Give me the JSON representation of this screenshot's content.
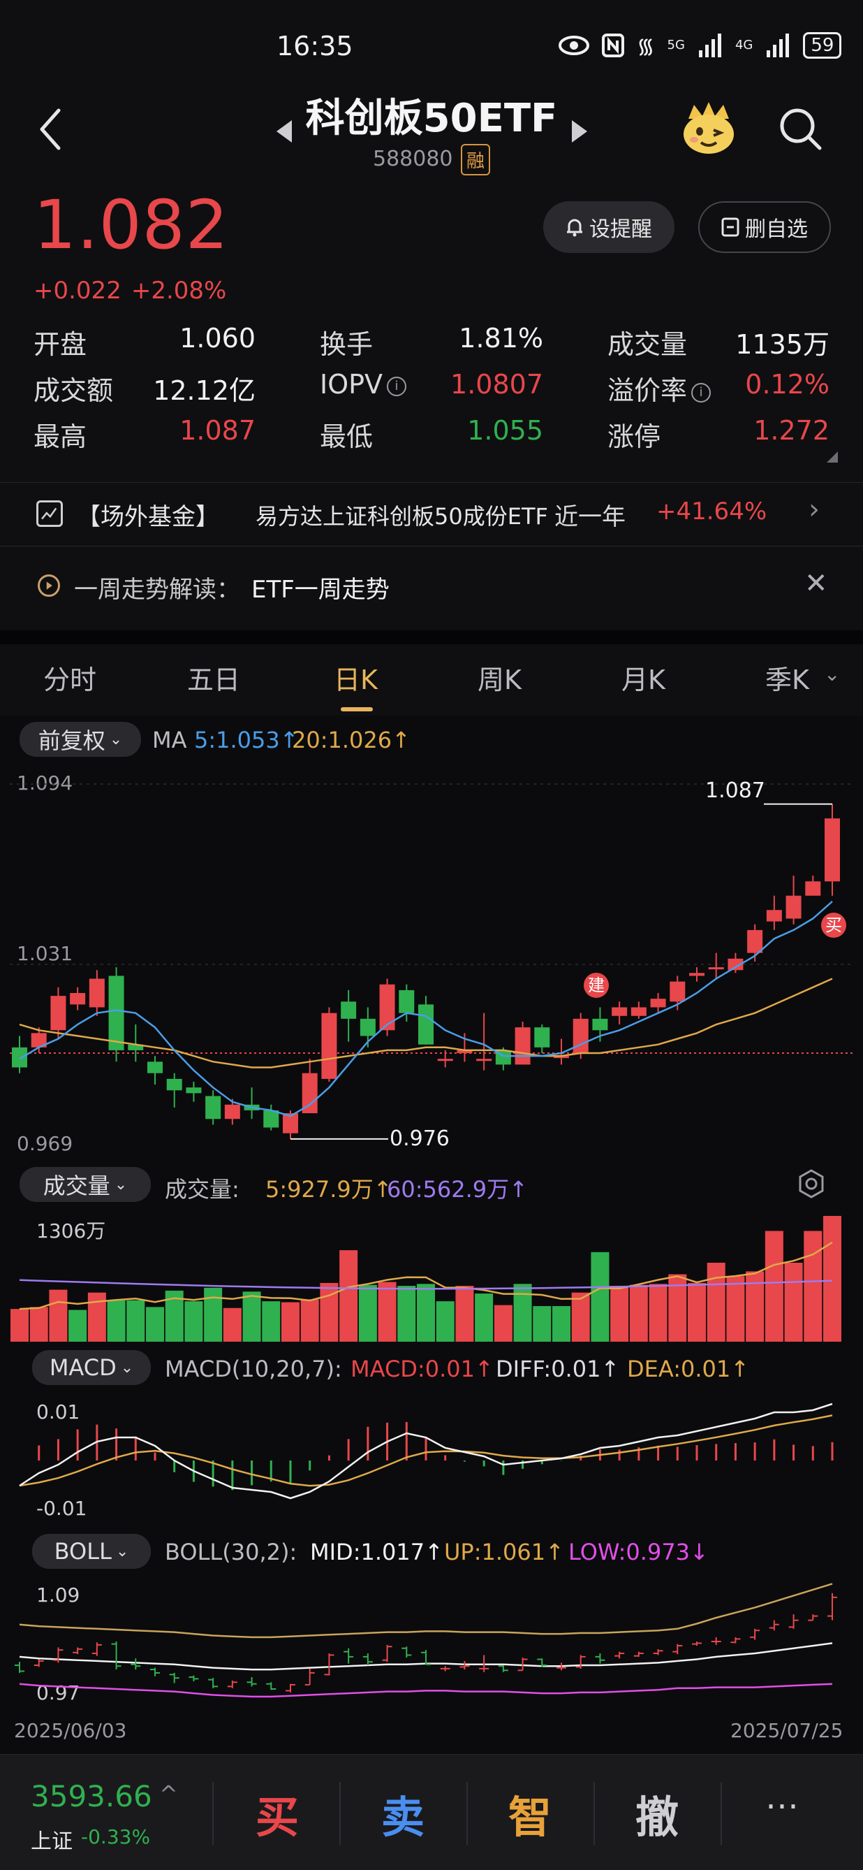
{
  "status": {
    "time": "16:35",
    "battery": "59",
    "signal1": "5G",
    "signal2": "4G"
  },
  "header": {
    "title": "科创板50ETF",
    "code": "588080",
    "badge": "融"
  },
  "price": {
    "last": "1.082",
    "change": "+0.022",
    "change_pct": "+2.08%"
  },
  "actions": {
    "alert": "设提醒",
    "fav": "删自选"
  },
  "stats": [
    {
      "label": "开盘",
      "value": "1.060",
      "tone": "white"
    },
    {
      "label": "换手",
      "value": "1.81%",
      "tone": "white"
    },
    {
      "label": "成交量",
      "value": "1135万",
      "tone": "white"
    },
    {
      "label": "成交额",
      "value": "12.12亿",
      "tone": "white"
    },
    {
      "label": "IOPV",
      "value": "1.0807",
      "tone": "red",
      "info": true
    },
    {
      "label": "溢价率",
      "value": "0.12%",
      "tone": "red",
      "info": true
    },
    {
      "label": "最高",
      "value": "1.087",
      "tone": "red"
    },
    {
      "label": "最低",
      "value": "1.055",
      "tone": "green"
    },
    {
      "label": "涨停",
      "value": "1.272",
      "tone": "red"
    }
  ],
  "fund": {
    "tag": "【场外基金】",
    "name": "易方达上证科创板50成份ETF",
    "period": "近一年",
    "return": "+41.64%"
  },
  "weekly": {
    "label": "一周走势解读：",
    "value": "ETF一周走势"
  },
  "tabs": [
    "分时",
    "五日",
    "日K",
    "周K",
    "月K",
    "季K"
  ],
  "active_tab": "日K",
  "kline": {
    "adjust": "前复权",
    "ma_label": "MA",
    "ma5": "5:1.053",
    "ma20": "20:1.026",
    "y_top": "1.094",
    "y_mid": "1.031",
    "y_bot": "0.969",
    "high_mark": "1.087",
    "low_mark": "0.976",
    "build_tag": "建",
    "buy_tag": "买",
    "colors": {
      "up": "#e8474b",
      "down": "#2fb14f",
      "ma5": "#4a9ee8",
      "ma20": "#e0a94a"
    }
  },
  "volume": {
    "selector": "成交量",
    "label": "成交量:",
    "ma5": "5:927.9万",
    "ma60": "60:562.9万",
    "y_top": "1306万",
    "y_bot": "0"
  },
  "macd": {
    "selector": "MACD",
    "params": "MACD(10,20,7):",
    "macd": "MACD:0.01",
    "diff": "DIFF:0.01",
    "dea": "DEA:0.01",
    "y_top": "0.01",
    "y_bot": "-0.01"
  },
  "boll": {
    "selector": "BOLL",
    "params": "BOLL(30,2):",
    "mid": "MID:1.017",
    "up": "UP:1.061",
    "low": "LOW:0.973",
    "y_top": "1.09",
    "y_bot": "0.97"
  },
  "dates": {
    "start": "2025/06/03",
    "end": "2025/07/25"
  },
  "chart_data": {
    "type": "candlestick",
    "x_range": [
      "2025/06/03",
      "2025/07/25"
    ],
    "ylim": [
      0.969,
      1.094
    ],
    "candles": [
      {
        "o": 1.002,
        "c": 0.995,
        "h": 1.006,
        "l": 0.993
      },
      {
        "o": 1.002,
        "c": 1.007,
        "h": 1.009,
        "l": 1.0
      },
      {
        "o": 1.008,
        "c": 1.02,
        "h": 1.023,
        "l": 1.005
      },
      {
        "o": 1.017,
        "c": 1.021,
        "h": 1.023,
        "l": 1.015
      },
      {
        "o": 1.016,
        "c": 1.026,
        "h": 1.029,
        "l": 1.013
      },
      {
        "o": 1.027,
        "c": 1.001,
        "h": 1.03,
        "l": 0.997
      },
      {
        "o": 1.003,
        "c": 1.001,
        "h": 1.01,
        "l": 0.997
      },
      {
        "o": 0.997,
        "c": 0.993,
        "h": 0.999,
        "l": 0.989
      },
      {
        "o": 0.991,
        "c": 0.987,
        "h": 0.993,
        "l": 0.981
      },
      {
        "o": 0.988,
        "c": 0.986,
        "h": 0.99,
        "l": 0.983
      },
      {
        "o": 0.985,
        "c": 0.977,
        "h": 0.987,
        "l": 0.975
      },
      {
        "o": 0.977,
        "c": 0.982,
        "h": 0.984,
        "l": 0.975
      },
      {
        "o": 0.982,
        "c": 0.98,
        "h": 0.988,
        "l": 0.977
      },
      {
        "o": 0.98,
        "c": 0.974,
        "h": 0.982,
        "l": 0.973
      },
      {
        "o": 0.972,
        "c": 0.979,
        "h": 0.98,
        "l": 0.97
      },
      {
        "o": 0.979,
        "c": 0.993,
        "h": 0.998,
        "l": 0.979
      },
      {
        "o": 0.991,
        "c": 1.014,
        "h": 1.016,
        "l": 0.99
      },
      {
        "o": 1.018,
        "c": 1.012,
        "h": 1.022,
        "l": 1.004
      },
      {
        "o": 1.012,
        "c": 1.006,
        "h": 1.016,
        "l": 1.002
      },
      {
        "o": 1.008,
        "c": 1.024,
        "h": 1.026,
        "l": 1.006
      },
      {
        "o": 1.022,
        "c": 1.014,
        "h": 1.024,
        "l": 1.011
      },
      {
        "o": 1.017,
        "c": 1.003,
        "h": 1.02,
        "l": 1.003
      },
      {
        "o": 0.998,
        "c": 0.998,
        "h": 1.001,
        "l": 0.995
      },
      {
        "o": 1.0,
        "c": 1.001,
        "h": 1.007,
        "l": 0.997
      },
      {
        "o": 0.998,
        "c": 0.998,
        "h": 1.014,
        "l": 0.994
      },
      {
        "o": 1.001,
        "c": 0.996,
        "h": 1.002,
        "l": 0.994
      },
      {
        "o": 0.996,
        "c": 1.009,
        "h": 1.011,
        "l": 0.996
      },
      {
        "o": 1.009,
        "c": 1.002,
        "h": 1.01,
        "l": 1.0
      },
      {
        "o": 0.999,
        "c": 0.999,
        "h": 1.005,
        "l": 0.996
      },
      {
        "o": 1.0,
        "c": 1.012,
        "h": 1.014,
        "l": 0.998
      },
      {
        "o": 1.012,
        "c": 1.008,
        "h": 1.016,
        "l": 1.004
      },
      {
        "o": 1.013,
        "c": 1.016,
        "h": 1.018,
        "l": 1.01
      },
      {
        "o": 1.013,
        "c": 1.016,
        "h": 1.018,
        "l": 1.012
      },
      {
        "o": 1.016,
        "c": 1.019,
        "h": 1.021,
        "l": 1.014
      },
      {
        "o": 1.018,
        "c": 1.025,
        "h": 1.027,
        "l": 1.015
      },
      {
        "o": 1.027,
        "c": 1.028,
        "h": 1.03,
        "l": 1.025
      },
      {
        "o": 1.03,
        "c": 1.03,
        "h": 1.035,
        "l": 1.026
      },
      {
        "o": 1.029,
        "c": 1.033,
        "h": 1.035,
        "l": 1.028
      },
      {
        "o": 1.035,
        "c": 1.043,
        "h": 1.045,
        "l": 1.032
      },
      {
        "o": 1.046,
        "c": 1.05,
        "h": 1.055,
        "l": 1.043
      },
      {
        "o": 1.047,
        "c": 1.055,
        "h": 1.062,
        "l": 1.045
      },
      {
        "o": 1.055,
        "c": 1.06,
        "h": 1.062,
        "l": 1.055
      },
      {
        "o": 1.06,
        "c": 1.082,
        "h": 1.087,
        "l": 1.055
      }
    ],
    "ma5": [
      0.998,
      1.002,
      1.005,
      1.01,
      1.014,
      1.015,
      1.014,
      1.009,
      1.001,
      0.994,
      0.988,
      0.983,
      0.981,
      0.98,
      0.978,
      0.982,
      0.988,
      0.996,
      1.004,
      1.01,
      1.014,
      1.013,
      1.008,
      1.005,
      1.003,
      0.999,
      0.999,
      0.999,
      1.0,
      1.003,
      1.006,
      1.008,
      1.011,
      1.014,
      1.017,
      1.021,
      1.026,
      1.03,
      1.034,
      1.04,
      1.043,
      1.047,
      1.053
    ],
    "ma20": [
      1.01,
      1.008,
      1.007,
      1.006,
      1.005,
      1.004,
      1.003,
      1.002,
      1.001,
      0.999,
      0.997,
      0.996,
      0.995,
      0.995,
      0.996,
      0.997,
      0.998,
      0.999,
      1.0,
      1.001,
      1.001,
      1.002,
      1.002,
      1.001,
      1.001,
      1.001,
      1.0,
      0.999,
      0.999,
      1.0,
      1.0,
      1.001,
      1.002,
      1.003,
      1.005,
      1.007,
      1.01,
      1.012,
      1.014,
      1.017,
      1.02,
      1.023,
      1.026
    ],
    "volume_max": 1306,
    "volume": [
      340,
      360,
      540,
      330,
      510,
      430,
      430,
      360,
      530,
      420,
      560,
      350,
      520,
      420,
      410,
      440,
      610,
      950,
      590,
      620,
      580,
      600,
      420,
      580,
      500,
      380,
      600,
      370,
      370,
      510,
      930,
      580,
      590,
      600,
      700,
      610,
      820,
      680,
      730,
      1150,
      820,
      1150,
      1306
    ],
    "volume_up": [
      true,
      true,
      true,
      false,
      true,
      false,
      false,
      false,
      false,
      false,
      false,
      true,
      false,
      false,
      true,
      true,
      true,
      true,
      false,
      true,
      false,
      false,
      false,
      true,
      false,
      true,
      false,
      false,
      false,
      true,
      false,
      true,
      true,
      true,
      true,
      true,
      true,
      true,
      true,
      true,
      true,
      true,
      true
    ]
  }
}
